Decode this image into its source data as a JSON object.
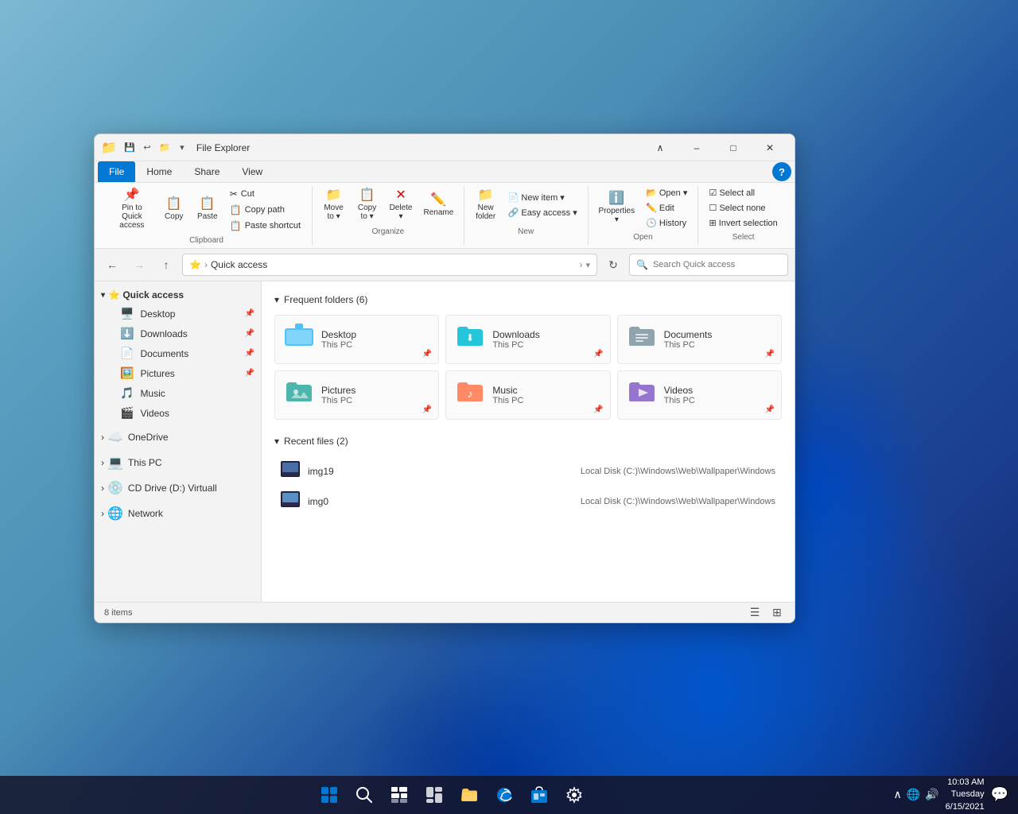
{
  "window": {
    "title": "File Explorer",
    "titlebar_icon": "📁"
  },
  "ribbon": {
    "tabs": [
      "File",
      "Home",
      "Share",
      "View"
    ],
    "active_tab": "Home",
    "groups": {
      "clipboard": {
        "label": "Clipboard",
        "buttons": [
          "Pin to Quick access",
          "Copy",
          "Paste"
        ],
        "small_buttons": [
          "Cut",
          "Copy path",
          "Paste shortcut"
        ]
      },
      "organize": {
        "label": "Organize",
        "buttons": [
          "Move to ▾",
          "Copy to ▾",
          "Delete ▾",
          "Rename"
        ]
      },
      "new": {
        "label": "New",
        "buttons": [
          "New item ▾",
          "Easy access ▾",
          "New folder"
        ]
      },
      "open": {
        "label": "Open",
        "buttons": [
          "Open ▾",
          "Edit",
          "History",
          "Properties ▾"
        ]
      },
      "select": {
        "label": "Select",
        "buttons": [
          "Select all",
          "Select none",
          "Invert selection"
        ]
      }
    }
  },
  "address_bar": {
    "path": "Quick access",
    "path_icon": "⭐",
    "search_placeholder": "Search Quick access",
    "back_disabled": false,
    "forward_disabled": true
  },
  "sidebar": {
    "quick_access": {
      "label": "Quick access",
      "expanded": true,
      "items": [
        {
          "name": "Desktop",
          "icon": "🖥️",
          "pinned": true
        },
        {
          "name": "Downloads",
          "icon": "⬇️",
          "pinned": true
        },
        {
          "name": "Documents",
          "icon": "📄",
          "pinned": true
        },
        {
          "name": "Pictures",
          "icon": "🖼️",
          "pinned": true
        },
        {
          "name": "Music",
          "icon": "🎵",
          "pinned": false
        },
        {
          "name": "Videos",
          "icon": "🎬",
          "pinned": false
        }
      ]
    },
    "onedrive": {
      "label": "OneDrive",
      "expanded": false
    },
    "this_pc": {
      "label": "This PC",
      "expanded": false
    },
    "cd_drive": {
      "label": "CD Drive (D:) Virtuall",
      "expanded": false
    },
    "network": {
      "label": "Network",
      "expanded": false
    }
  },
  "content": {
    "frequent_folders": {
      "label": "Frequent folders (6)",
      "folders": [
        {
          "name": "Desktop",
          "sub": "This PC",
          "icon": "desktop",
          "pin": "📌"
        },
        {
          "name": "Downloads",
          "sub": "This PC",
          "icon": "downloads",
          "pin": "📌"
        },
        {
          "name": "Documents",
          "sub": "This PC",
          "icon": "documents",
          "pin": "📌"
        },
        {
          "name": "Pictures",
          "sub": "This PC",
          "icon": "pictures",
          "pin": "📌"
        },
        {
          "name": "Music",
          "sub": "This PC",
          "icon": "music",
          "pin": "📌"
        },
        {
          "name": "Videos",
          "sub": "This PC",
          "icon": "videos",
          "pin": "📌"
        }
      ]
    },
    "recent_files": {
      "label": "Recent files (2)",
      "files": [
        {
          "name": "img19",
          "path": "Local Disk (C:)\\Windows\\Web\\Wallpaper\\Windows"
        },
        {
          "name": "img0",
          "path": "Local Disk (C:)\\Windows\\Web\\Wallpaper\\Windows"
        }
      ]
    }
  },
  "status_bar": {
    "items_count": "8 items"
  },
  "taskbar": {
    "time": "10:03 AM",
    "date": "Tuesday\n6/15/2021",
    "icons": [
      "start",
      "search",
      "taskview",
      "widgets",
      "folder",
      "edge",
      "store",
      "settings"
    ]
  }
}
